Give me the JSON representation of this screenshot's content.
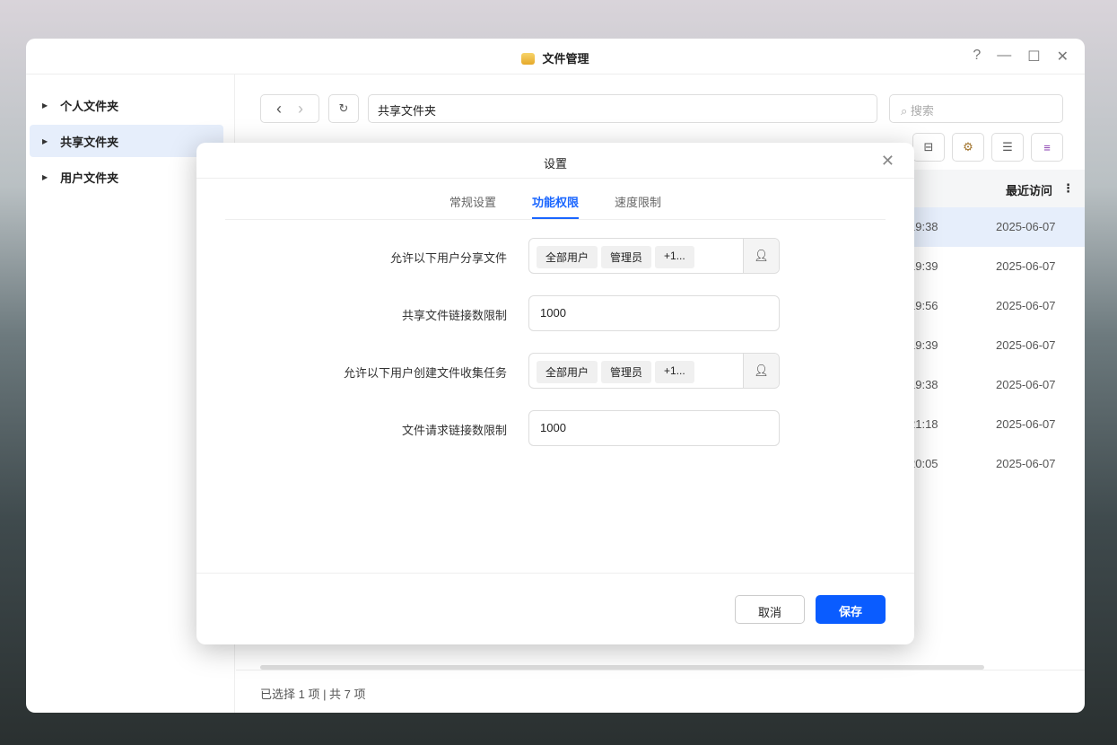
{
  "window": {
    "title": "文件管理",
    "help": "?",
    "minimize": "—",
    "maximize": "☐",
    "close": "✕"
  },
  "sidebar": {
    "items": [
      {
        "label": "个人文件夹"
      },
      {
        "label": "共享文件夹"
      },
      {
        "label": "用户文件夹"
      }
    ]
  },
  "toolbar": {
    "back": "‹",
    "forward": "›",
    "refresh": "↻",
    "path": "共享文件夹",
    "search_placeholder": "搜索"
  },
  "table": {
    "header_last": "最近访问",
    "rows": [
      {
        "time": "19:38",
        "date": "2025-06-07"
      },
      {
        "time": "19:39",
        "date": "2025-06-07"
      },
      {
        "time": "19:56",
        "date": "2025-06-07"
      },
      {
        "time": "19:39",
        "date": "2025-06-07"
      },
      {
        "time": "19:38",
        "date": "2025-06-07"
      },
      {
        "time": "21:18",
        "date": "2025-06-07"
      },
      {
        "time": "20:05",
        "date": "2025-06-07"
      }
    ]
  },
  "status": "已选择 1 项 | 共 7 项",
  "dialog": {
    "title": "设置",
    "tabs": [
      "常规设置",
      "功能权限",
      "速度限制"
    ],
    "fields": [
      {
        "label": "允许以下用户分享文件",
        "tags": [
          "全部用户",
          "管理员",
          "+1..."
        ]
      },
      {
        "label": "共享文件链接数限制",
        "value": "1000"
      },
      {
        "label": "允许以下用户创建文件收集任务",
        "tags": [
          "全部用户",
          "管理员",
          "+1..."
        ]
      },
      {
        "label": "文件请求链接数限制",
        "value": "1000"
      }
    ],
    "cancel": "取消",
    "save": "保存"
  }
}
